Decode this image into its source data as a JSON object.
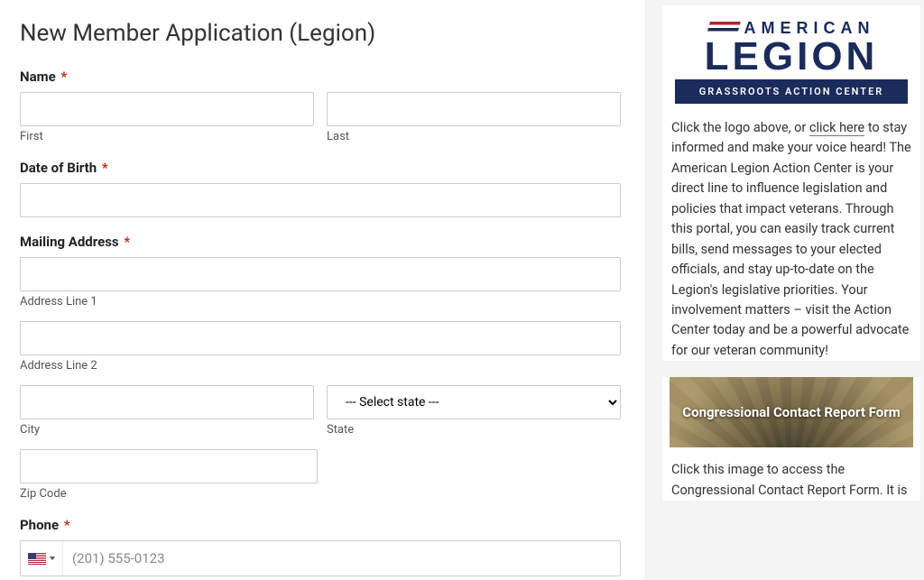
{
  "form": {
    "title": "New Member Application (Legion)",
    "name": {
      "label": "Name",
      "first_sub": "First",
      "last_sub": "Last"
    },
    "dob": {
      "label": "Date of Birth"
    },
    "mailing": {
      "label": "Mailing Address",
      "line1_sub": "Address Line 1",
      "line2_sub": "Address Line 2",
      "city_sub": "City",
      "state_sub": "State",
      "state_placeholder": "--- Select state ---",
      "zip_sub": "Zip Code"
    },
    "phone": {
      "label": "Phone",
      "placeholder": "(201) 555-0123"
    },
    "required_marker": "*"
  },
  "sidebar": {
    "logo": {
      "top": "AMERICAN",
      "main": "LEGION",
      "bar": "GRASSROOTS ACTION CENTER"
    },
    "text_before_link": "Click the logo above, or ",
    "link_text": "click here",
    "text_after_link": " to stay informed and make your voice heard! The American Legion Action Center is your direct line to influence legislation and policies that impact veterans. Through this portal, you can easily track current bills, send messages to your elected officials, and stay up-to-date on the Legion's legislative priorities. Your involvement matters – visit the Action Center today and be a powerful advocate for our veteran community!",
    "banner_title": "Congressional Contact Report Form",
    "text2": "Click this image to access  the Congressional Contact Report Form. It is"
  }
}
